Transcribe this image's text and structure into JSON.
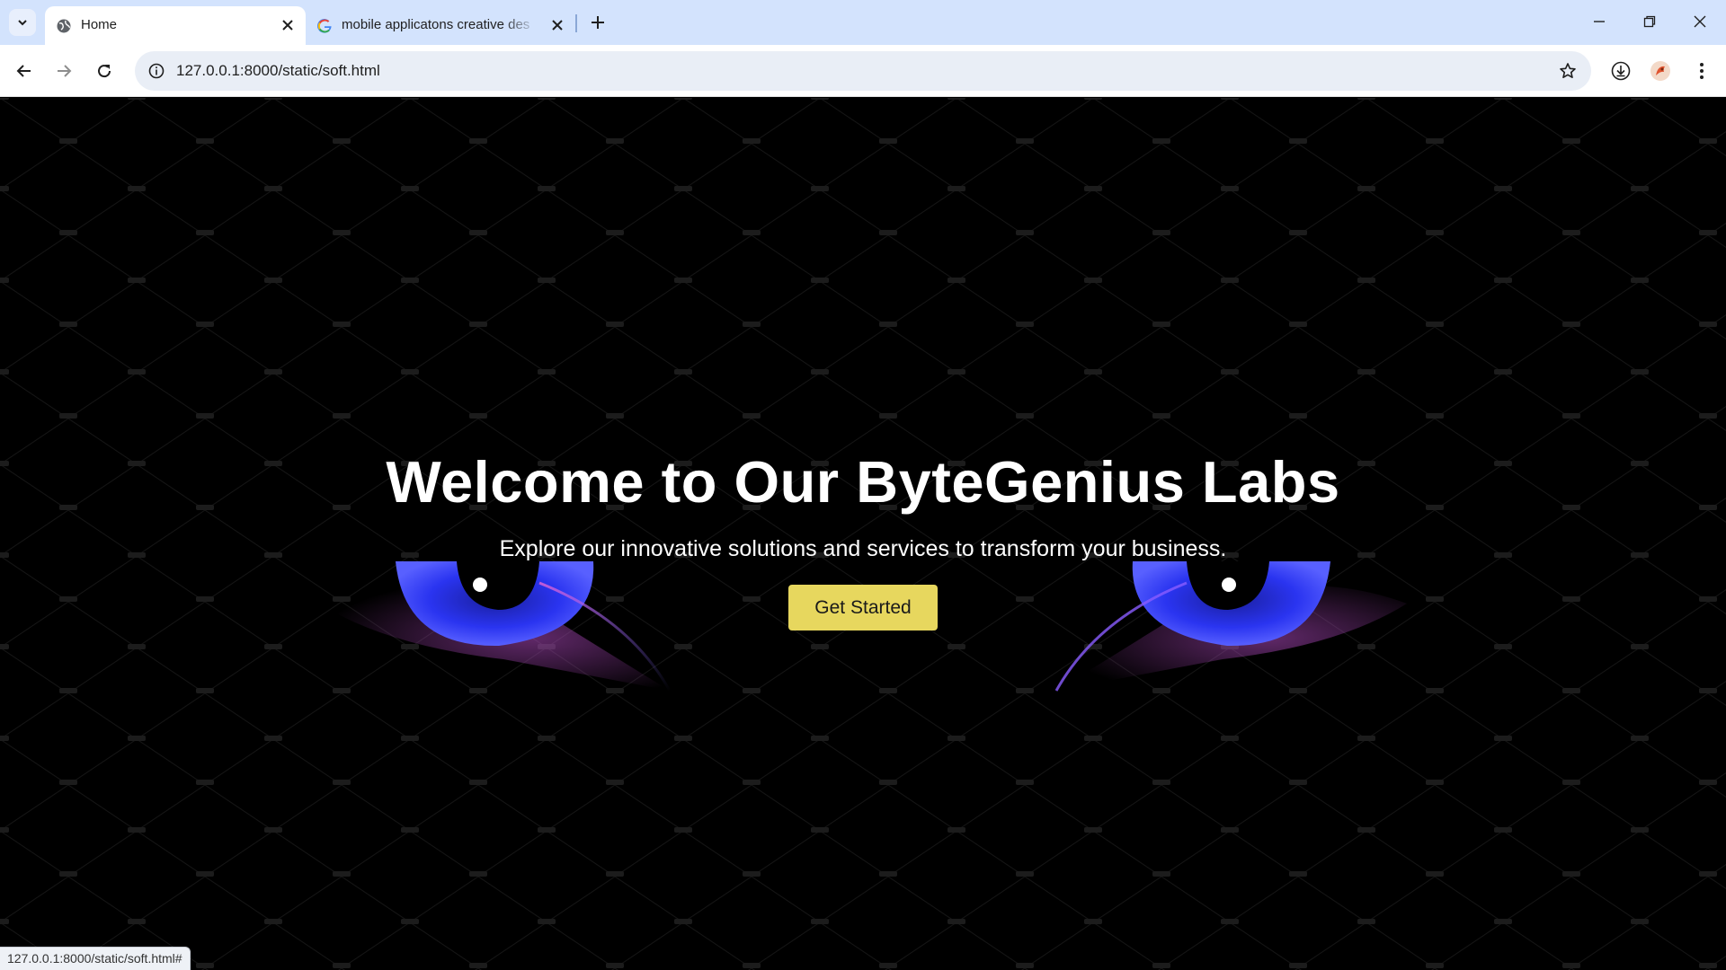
{
  "browser": {
    "tabs": [
      {
        "title": "Home",
        "favicon": "globe-icon",
        "active": true
      },
      {
        "title": "mobile applicatons creative des",
        "favicon": "google-g-icon",
        "active": false
      }
    ],
    "url": "127.0.0.1:8000/static/soft.html",
    "status_url": "127.0.0.1:8000/static/soft.html#"
  },
  "hero": {
    "title": "Welcome to Our ByteGenius Labs",
    "subtitle": "Explore our innovative solutions and services to transform your business.",
    "cta_label": "Get Started"
  },
  "background": {
    "base_color": "#000000",
    "watermark_text": "Creative",
    "eye_colors": {
      "iris": "#2a34f0",
      "glow": "#b04ac0"
    }
  },
  "colors": {
    "titlebar": "#d3e3fd",
    "cta": "#e7d75e"
  }
}
